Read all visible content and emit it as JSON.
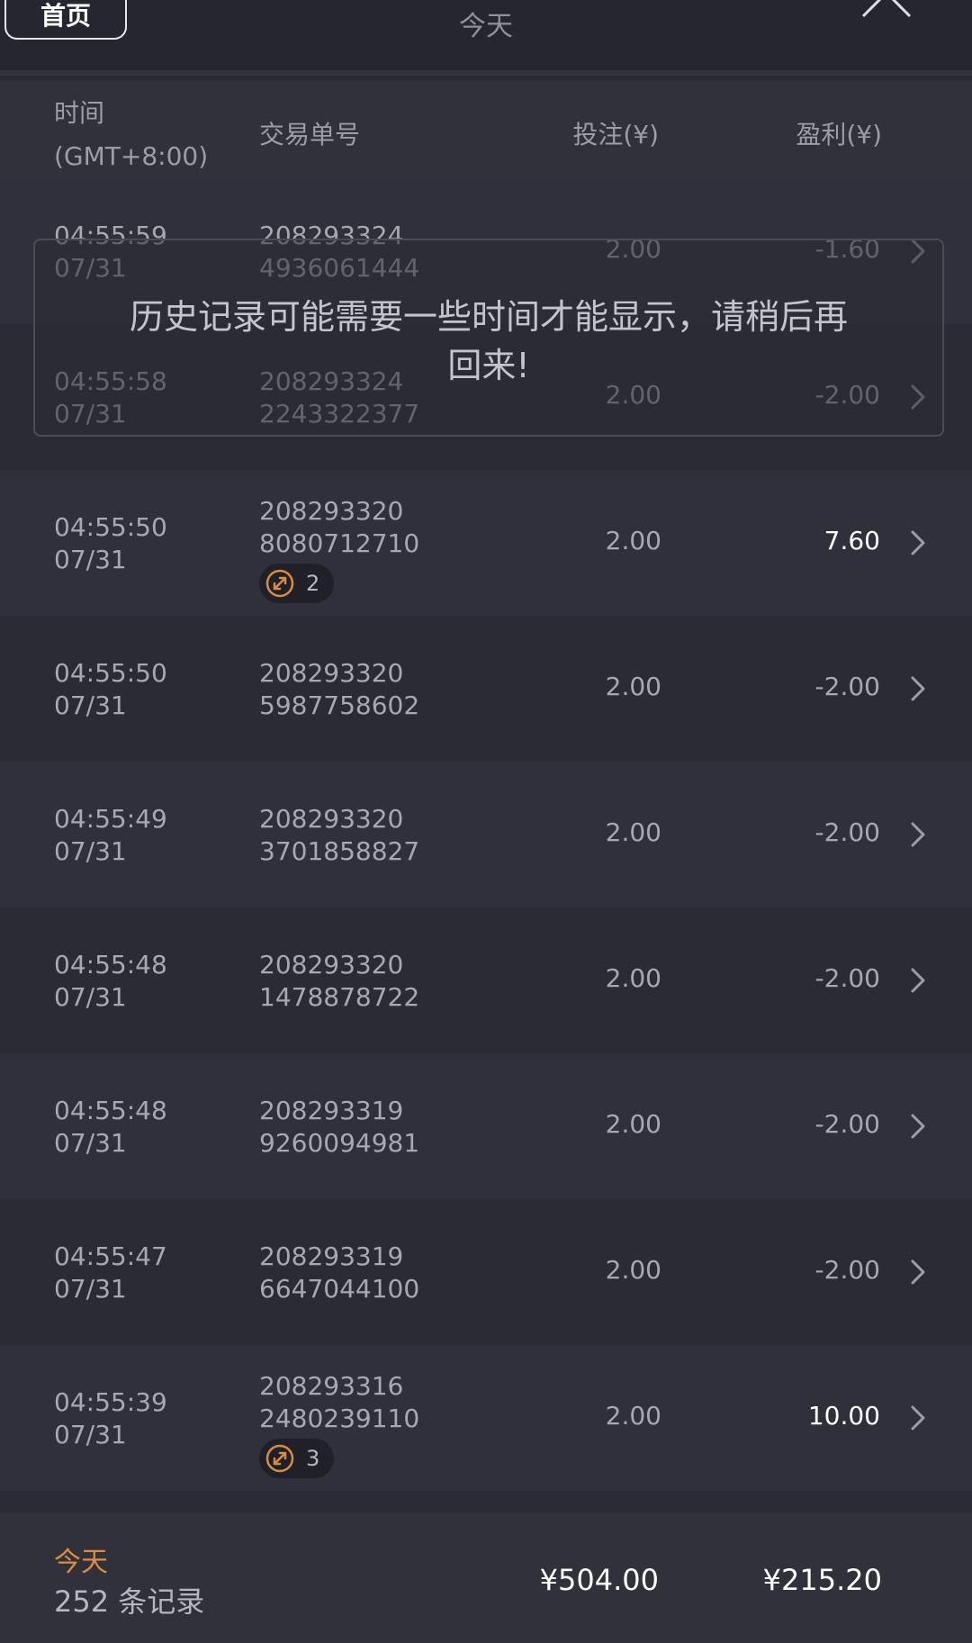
{
  "topbar": {
    "home_label": "首页",
    "title": "今天"
  },
  "header": {
    "time_label": "时间",
    "timezone_label": "(GMT+8:00)",
    "id_label": "交易单号",
    "bet_label": "投注(¥)",
    "profit_label": "盈利(¥)"
  },
  "rows": [
    {
      "time": "04:55:59",
      "date": "07/31",
      "id_line1": "208293324",
      "id_line2": "4936061444",
      "bet": "2.00",
      "profit": "-1.60",
      "badge": ""
    },
    {
      "time": "04:55:58",
      "date": "07/31",
      "id_line1": "208293324",
      "id_line2": "2243322377",
      "bet": "2.00",
      "profit": "-2.00",
      "badge": ""
    },
    {
      "time": "04:55:50",
      "date": "07/31",
      "id_line1": "208293320",
      "id_line2": "8080712710",
      "bet": "2.00",
      "profit": "7.60",
      "badge": "2"
    },
    {
      "time": "04:55:50",
      "date": "07/31",
      "id_line1": "208293320",
      "id_line2": "5987758602",
      "bet": "2.00",
      "profit": "-2.00",
      "badge": ""
    },
    {
      "time": "04:55:49",
      "date": "07/31",
      "id_line1": "208293320",
      "id_line2": "3701858827",
      "bet": "2.00",
      "profit": "-2.00",
      "badge": ""
    },
    {
      "time": "04:55:48",
      "date": "07/31",
      "id_line1": "208293320",
      "id_line2": "1478878722",
      "bet": "2.00",
      "profit": "-2.00",
      "badge": ""
    },
    {
      "time": "04:55:48",
      "date": "07/31",
      "id_line1": "208293319",
      "id_line2": "9260094981",
      "bet": "2.00",
      "profit": "-2.00",
      "badge": ""
    },
    {
      "time": "04:55:47",
      "date": "07/31",
      "id_line1": "208293319",
      "id_line2": "6647044100",
      "bet": "2.00",
      "profit": "-2.00",
      "badge": ""
    },
    {
      "time": "04:55:39",
      "date": "07/31",
      "id_line1": "208293316",
      "id_line2": "2480239110",
      "bet": "2.00",
      "profit": "10.00",
      "badge": "3"
    }
  ],
  "toast": {
    "line1": "历史记录可能需要一些时间才能显示，请稍后再",
    "line2": "回来!"
  },
  "footer": {
    "period": "今天",
    "count": "252 条记录",
    "total_bet": "¥504.00",
    "total_profit": "¥215.20"
  },
  "colors": {
    "background": "#2a2b35",
    "row_alt": "#2f303b",
    "accent_orange": "#d98c43",
    "positive_profit": "#ffffff"
  },
  "icons": {
    "close": "close-icon",
    "row_detail": "chevron-right-icon",
    "badge": "swap-arrows-icon"
  }
}
